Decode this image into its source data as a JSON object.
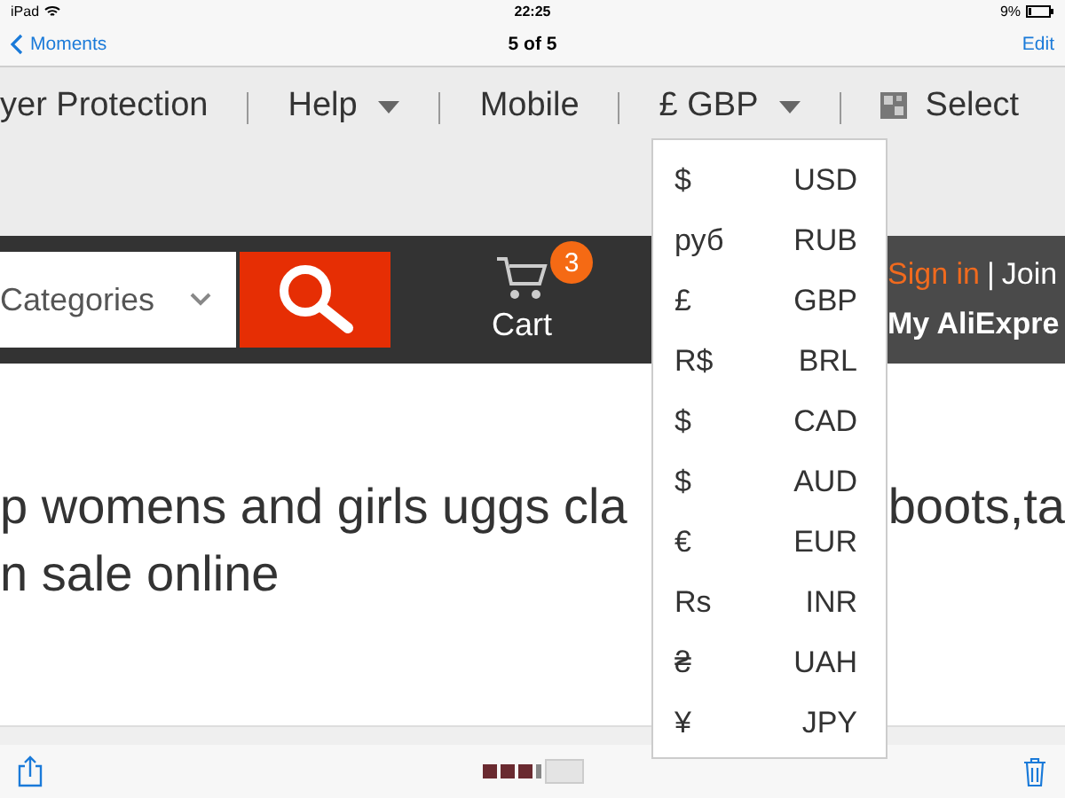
{
  "status_bar": {
    "device": "iPad",
    "time": "22:25",
    "battery": "9%"
  },
  "nav": {
    "back": "Moments",
    "title": "5 of 5",
    "action": "Edit"
  },
  "top_links": [
    {
      "label": "yer Protection",
      "kind": "link"
    },
    {
      "label": "Help",
      "kind": "menu"
    },
    {
      "label": "Mobile",
      "kind": "link"
    },
    {
      "label": "£ GBP",
      "kind": "menu"
    },
    {
      "label": "Select",
      "kind": "flag"
    }
  ],
  "search": {
    "category": "Categories"
  },
  "cart": {
    "label": "Cart",
    "count": "3"
  },
  "account": {
    "sign_in": "Sign in",
    "separator": "|",
    "join": "Join",
    "my": "My AliExpre"
  },
  "product_title": {
    "line_1": "p womens and girls uggs cla",
    "line_1_end": "boots,ta",
    "line_2": "n sale online"
  },
  "currency_menu": [
    {
      "symbol": "$",
      "code": "USD"
    },
    {
      "symbol": "руб",
      "code": "RUB"
    },
    {
      "symbol": "£",
      "code": "GBP"
    },
    {
      "symbol": "R$",
      "code": "BRL"
    },
    {
      "symbol": "$",
      "code": "CAD"
    },
    {
      "symbol": "$",
      "code": "AUD"
    },
    {
      "symbol": "€",
      "code": "EUR"
    },
    {
      "symbol": "Rs",
      "code": "INR"
    },
    {
      "symbol": "₴",
      "code": "UAH"
    },
    {
      "symbol": "¥",
      "code": "JPY"
    }
  ]
}
